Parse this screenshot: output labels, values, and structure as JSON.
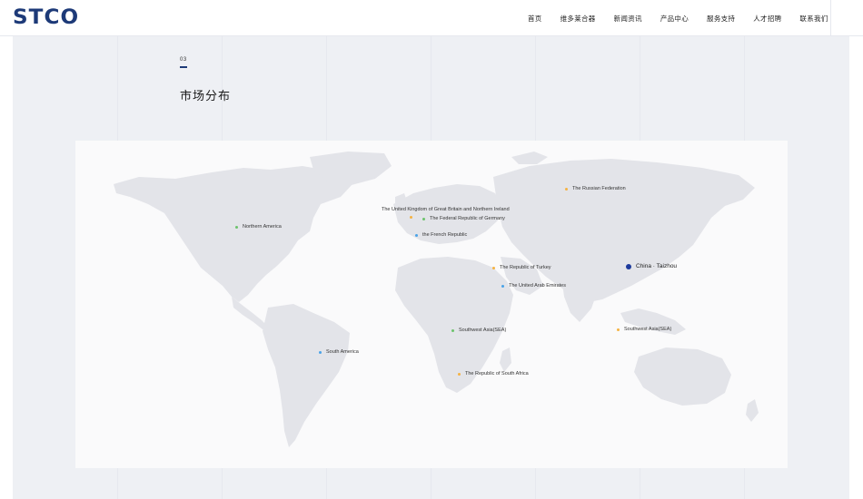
{
  "header": {
    "logo": "STCO",
    "nav": [
      "首页",
      "维多莱合器",
      "新闻资讯",
      "产品中心",
      "服务支持",
      "人才招聘",
      "联系我们"
    ]
  },
  "section": {
    "number": "03",
    "title": "市场分布"
  },
  "markers": [
    {
      "label": "The Russian Federation",
      "color": "#f5b342"
    },
    {
      "label": "Northern America",
      "color": "#6cc36c"
    },
    {
      "label": "The United Kingdom of Great Britain and Northern Ireland",
      "color": "#f5b342"
    },
    {
      "label": "The Federal Republic of Germany",
      "color": "#6cc36c"
    },
    {
      "label": "the French Republic",
      "color": "#4aa3e8"
    },
    {
      "label": "The Republic of Turkey",
      "color": "#f5b342"
    },
    {
      "label": "China · Taizhou",
      "color": "#1d3a9c"
    },
    {
      "label": "The United Arab Emirates",
      "color": "#4aa3e8"
    },
    {
      "label": "Southwest Asia(SEA)",
      "color": "#f5b342"
    },
    {
      "label": "Southwest Asia(SEA)",
      "color": "#6cc36c"
    },
    {
      "label": "South America",
      "color": "#4aa3e8"
    },
    {
      "label": "The Republic of South Africa",
      "color": "#f5b342"
    }
  ]
}
